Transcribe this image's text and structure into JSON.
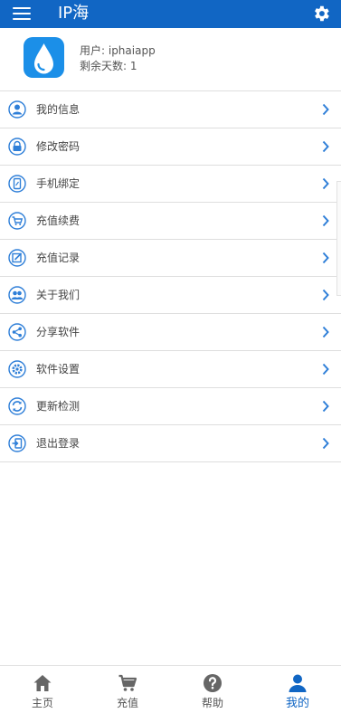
{
  "header": {
    "title": "IP海"
  },
  "profile": {
    "username": "用户: iphaiapp",
    "days_remaining": "剩余天数: 1"
  },
  "menu": [
    {
      "label": "我的信息",
      "icon": "user-icon"
    },
    {
      "label": "修改密码",
      "icon": "lock-icon"
    },
    {
      "label": "手机绑定",
      "icon": "phone-icon"
    },
    {
      "label": "充值续费",
      "icon": "cart-icon"
    },
    {
      "label": "充值记录",
      "icon": "edit-icon"
    },
    {
      "label": "关于我们",
      "icon": "group-icon"
    },
    {
      "label": "分享软件",
      "icon": "share-icon"
    },
    {
      "label": "软件设置",
      "icon": "gear-icon"
    },
    {
      "label": "更新检测",
      "icon": "refresh-icon"
    },
    {
      "label": "退出登录",
      "icon": "logout-icon"
    }
  ],
  "tabs": [
    {
      "label": "主页",
      "icon": "home-icon"
    },
    {
      "label": "充值",
      "icon": "cart-icon"
    },
    {
      "label": "帮助",
      "icon": "help-icon"
    },
    {
      "label": "我的",
      "icon": "user-icon",
      "active": true
    }
  ],
  "colors": {
    "primary": "#1166c4",
    "icon_blue": "#2f7fd8",
    "tab_gray": "#666666"
  }
}
